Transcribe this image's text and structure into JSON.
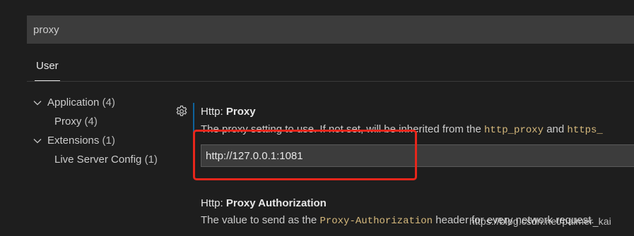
{
  "search": {
    "value": "proxy"
  },
  "tabs": [
    {
      "label": "User"
    }
  ],
  "toc": {
    "groups": [
      {
        "label": "Application",
        "count": "(4)",
        "children": [
          {
            "label": "Proxy",
            "count": "(4)"
          }
        ]
      },
      {
        "label": "Extensions",
        "count": "(1)",
        "children": [
          {
            "label": "Live Server Config",
            "count": "(1)"
          }
        ]
      }
    ]
  },
  "settings": [
    {
      "category": "Http: ",
      "name": "Proxy",
      "desc_pre": "The proxy setting to use. If not set, will be inherited from the ",
      "code1": "http_proxy",
      "desc_mid": " and ",
      "code2": "https_",
      "value": "http://127.0.0.1:1081"
    },
    {
      "category": "Http: ",
      "name": "Proxy Authorization",
      "desc_pre": "The value to send as the ",
      "code1": "Proxy-Authorization",
      "desc_mid": " header for every network request."
    }
  ],
  "watermark": "https://blog.csdn.net/palmer_kai",
  "icons": {
    "gear": "gear-icon",
    "chevron": "chevron-down-icon"
  },
  "colors": {
    "background": "#1e1e1e",
    "input": "#3c3c3c",
    "accent_bar": "#0e639c",
    "highlight_box": "#e8261b",
    "code_text": "#d7ba7d"
  }
}
